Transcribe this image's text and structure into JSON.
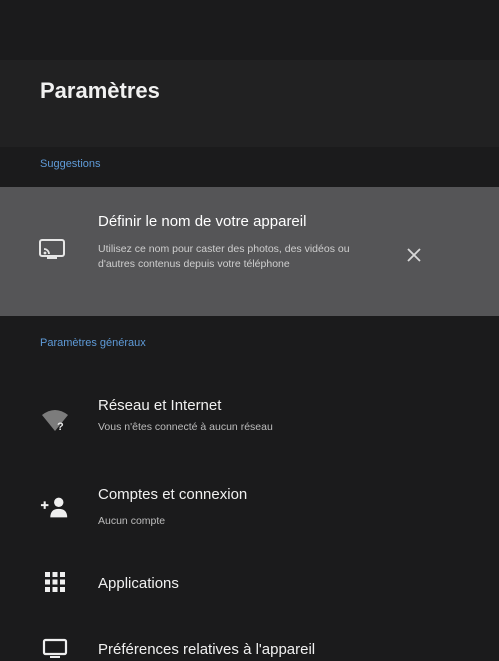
{
  "header": {
    "title": "Paramètres"
  },
  "suggestions": {
    "section_label": "Suggestions",
    "card": {
      "icon": "cast-screen-icon",
      "title": "Définir le nom de votre appareil",
      "description": "Utilisez ce nom pour caster des photos, des vidéos ou d'autres contenus depuis votre téléphone",
      "dismiss_icon": "close-icon"
    }
  },
  "general": {
    "section_label": "Paramètres généraux",
    "items": [
      {
        "icon": "wifi-question-icon",
        "title": "Réseau et Internet",
        "subtitle": "Vous n'êtes connecté à aucun réseau"
      },
      {
        "icon": "add-account-icon",
        "title": "Comptes et connexion",
        "subtitle": "Aucun compte"
      },
      {
        "icon": "apps-grid-icon",
        "title": "Applications"
      },
      {
        "icon": "tv-display-icon",
        "title": "Préférences relatives à l'appareil"
      }
    ]
  },
  "colors": {
    "background": "#1b1b1c",
    "header": "#212122",
    "highlight_card": "#555557",
    "section_accent": "#5f9bd8"
  }
}
